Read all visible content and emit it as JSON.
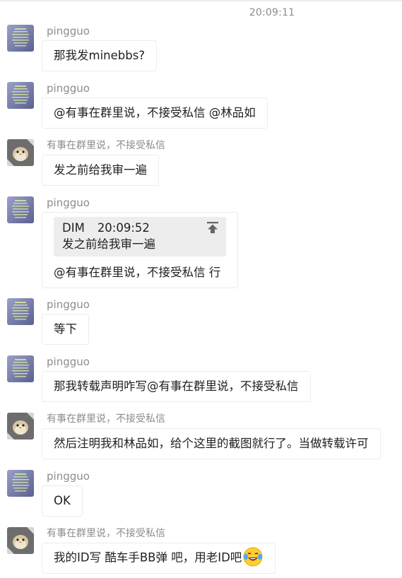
{
  "timestamp": "20:09:11",
  "colors": {
    "background": "#ffffff",
    "meta_text": "#8c8c8c",
    "bubble_border": "#ececec",
    "quote_bg": "#ededed"
  },
  "messages": [
    {
      "sender": "pingguo",
      "avatar": "pingguo-avatar",
      "text": "那我发minebbs?"
    },
    {
      "sender": "pingguo",
      "avatar": "pingguo-avatar",
      "text": "@有事在群里说，不接受私信 @林品如"
    },
    {
      "sender": "有事在群里说，不接受私信",
      "avatar": "bird-avatar",
      "text": "发之前给我审一遍"
    },
    {
      "sender": "pingguo",
      "avatar": "pingguo-avatar",
      "quote": {
        "author": "DIM",
        "time": "20:09:52",
        "text": "发之前给我审一遍",
        "icon": "pin-to-top-icon"
      },
      "text": "@有事在群里说，不接受私信 行"
    },
    {
      "sender": "pingguo",
      "avatar": "pingguo-avatar",
      "text": "等下"
    },
    {
      "sender": "pingguo",
      "avatar": "pingguo-avatar",
      "text": "那我转载声明咋写@有事在群里说，不接受私信"
    },
    {
      "sender": "有事在群里说，不接受私信",
      "avatar": "bird-avatar",
      "text": "然后注明我和林品如，给个这里的截图就行了。当做转载许可"
    },
    {
      "sender": "pingguo",
      "avatar": "pingguo-avatar",
      "text": "OK"
    },
    {
      "sender": "有事在群里说，不接受私信",
      "avatar": "bird-avatar",
      "text": "我的ID写 酷车手BB弹 吧，用老ID吧",
      "emoji": "laughing-tears-emoji"
    }
  ]
}
